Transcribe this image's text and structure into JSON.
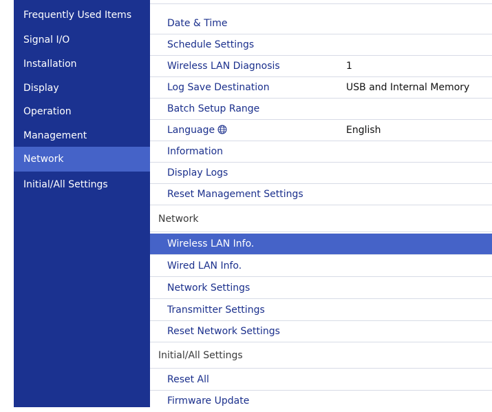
{
  "sidebar": {
    "items": [
      {
        "label": "Frequently Used Items"
      },
      {
        "label": "Signal I/O"
      },
      {
        "label": "Installation"
      },
      {
        "label": "Display"
      },
      {
        "label": "Operation"
      },
      {
        "label": "Management"
      },
      {
        "label": "Network",
        "selected": true
      },
      {
        "label": "Initial/All Settings"
      }
    ]
  },
  "menu": {
    "management": {
      "items": [
        {
          "label": "Date & Time"
        },
        {
          "label": "Schedule Settings"
        },
        {
          "label": "Wireless LAN Diagnosis",
          "value": "1"
        },
        {
          "label": "Log Save Destination",
          "value": "USB and Internal Memory"
        },
        {
          "label": "Batch Setup Range"
        },
        {
          "label": "Language",
          "value": "English",
          "icon": "globe-icon"
        },
        {
          "label": "Information"
        },
        {
          "label": "Display Logs"
        },
        {
          "label": "Reset Management Settings"
        }
      ]
    },
    "network": {
      "header": "Network",
      "items": [
        {
          "label": "Wireless LAN Info.",
          "selected": true
        },
        {
          "label": "Wired LAN Info."
        },
        {
          "label": "Network Settings"
        },
        {
          "label": "Transmitter Settings"
        },
        {
          "label": "Reset Network Settings"
        }
      ]
    },
    "initial": {
      "header": "Initial/All Settings",
      "items": [
        {
          "label": "Reset All"
        },
        {
          "label": "Firmware Update"
        }
      ]
    }
  },
  "colors": {
    "sidebar_bg": "#1b3290",
    "selection": "#4563c8",
    "item_text": "#1a2f8c"
  }
}
